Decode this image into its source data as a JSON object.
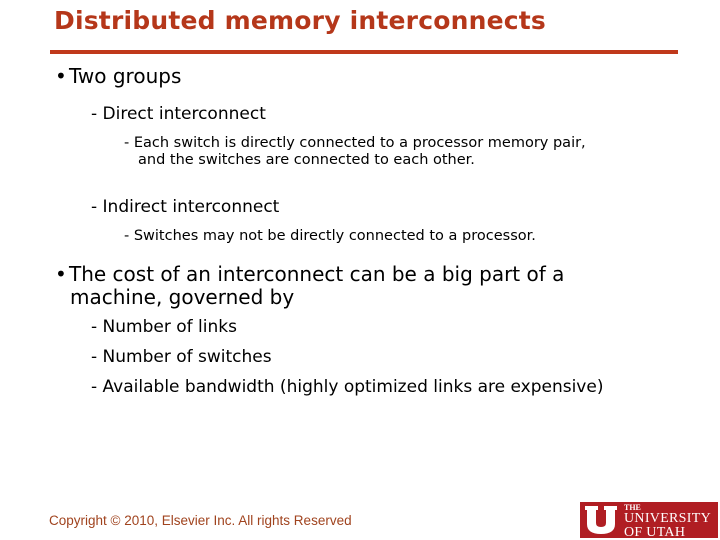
{
  "slide": {
    "title": "Distributed memory interconnects",
    "accent_color": "#b5371a",
    "bullets": [
      {
        "text": "Two groups",
        "children": [
          {
            "text": "Direct interconnect",
            "children": [
              {
                "text_line1": "Each switch is directly connected to a processor memory pair,",
                "text_line2": "and the switches are connected to each other."
              }
            ]
          },
          {
            "text": "Indirect interconnect",
            "children": [
              {
                "text": "Switches may not be directly connected to a processor."
              }
            ]
          }
        ]
      },
      {
        "text_line1": "The cost of an interconnect can be a big part of a",
        "text_line2": "machine, governed by",
        "children": [
          {
            "text": "Number of links"
          },
          {
            "text": "Number of switches"
          },
          {
            "text": "Available bandwidth (highly optimized links are expensive)"
          }
        ]
      }
    ],
    "bullet_glyph": "•",
    "dash_glyph": "-"
  },
  "footer": {
    "copyright": "Copyright © 2010, Elsevier Inc. All rights Reserved",
    "logo": {
      "line1": "THE",
      "line2": "UNIVERSITY",
      "line3": "OF UTAH",
      "color": "#b01e23"
    }
  }
}
